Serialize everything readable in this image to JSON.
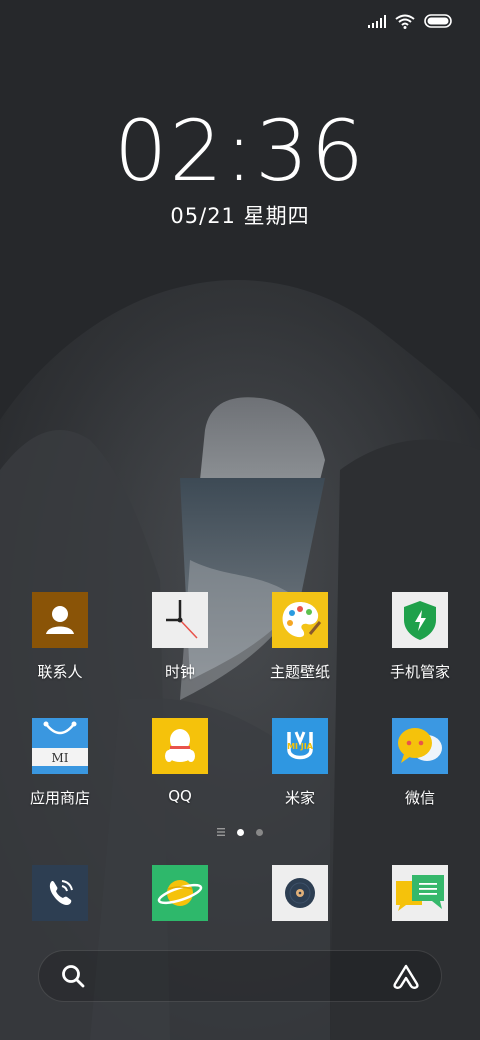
{
  "status_bar": {
    "signal_icon": "signal-icon",
    "wifi_icon": "wifi-icon",
    "battery_icon": "battery-icon"
  },
  "lockscreen": {
    "time": "02:36",
    "date": "05/21 星期四"
  },
  "apps_row1": [
    {
      "label": "联系人",
      "icon": "contacts-icon"
    },
    {
      "label": "时钟",
      "icon": "clock-icon"
    },
    {
      "label": "主题壁纸",
      "icon": "themes-palette-icon"
    },
    {
      "label": "手机管家",
      "icon": "security-shield-icon"
    }
  ],
  "apps_row2": [
    {
      "label": "应用商店",
      "icon": "app-store-bag-icon",
      "icon_text": "MI"
    },
    {
      "label": "QQ",
      "icon": "qq-penguin-icon"
    },
    {
      "label": "米家",
      "icon": "mijia-icon",
      "icon_text": "MI JIA"
    },
    {
      "label": "微信",
      "icon": "wechat-icon"
    }
  ],
  "page_indicator": {
    "pages": 3,
    "active_index": 1
  },
  "dock": [
    {
      "icon": "phone-icon"
    },
    {
      "icon": "browser-planet-icon"
    },
    {
      "icon": "music-disc-icon"
    },
    {
      "icon": "messages-icon"
    }
  ],
  "search_bar": {
    "search_icon": "search-icon",
    "assistant_icon": "ai-assistant-icon"
  },
  "colors": {
    "contacts": "#8a5407",
    "clock": "#eeeeee",
    "themes": "#f3c316",
    "security": "#eeeeee",
    "app_store": "#3a97e0",
    "qq": "#f5c20b",
    "mijia": "#2f97e1",
    "wechat": "#3b98e2",
    "phone": "#2d3e52",
    "browser": "#2eb86b",
    "music": "#eeeeee",
    "messages": "#eeeeee"
  }
}
